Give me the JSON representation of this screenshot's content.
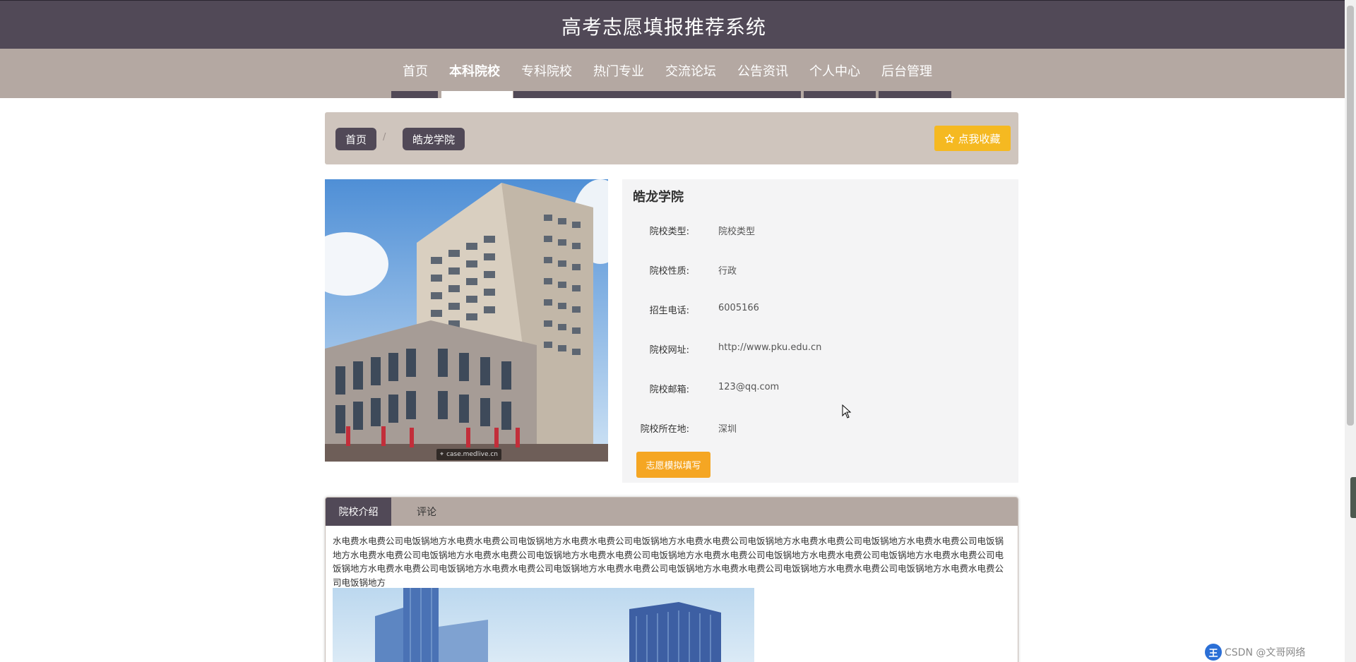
{
  "header": {
    "title": "高考志愿填报推荐系统"
  },
  "nav": {
    "items": [
      {
        "label": "首页"
      },
      {
        "label": "本科院校",
        "active": true
      },
      {
        "label": "专科院校"
      },
      {
        "label": "热门专业"
      },
      {
        "label": "交流论坛"
      },
      {
        "label": "公告资讯"
      },
      {
        "label": "个人中心"
      },
      {
        "label": "后台管理"
      }
    ]
  },
  "breadcrumb": {
    "home": "首页",
    "separator": "/",
    "current": "皓龙学院"
  },
  "favorite_button": {
    "icon": "star-outline-icon",
    "label": "点我收藏"
  },
  "photo": {
    "watermark": "case.medlive.cn"
  },
  "school": {
    "name": "皓龙学院",
    "fields": [
      {
        "label": "院校类型:",
        "value": "院校类型"
      },
      {
        "label": "院校性质:",
        "value": "行政"
      },
      {
        "label": "招生电话:",
        "value": "6005166"
      },
      {
        "label": "院校网址:",
        "value": "http://www.pku.edu.cn"
      },
      {
        "label": "院校邮箱:",
        "value": "123@qq.com"
      },
      {
        "label": "院校所在地:",
        "value": "深圳"
      }
    ],
    "apply_button": "志愿模拟填写"
  },
  "tabs": [
    {
      "label": "院校介绍",
      "active": true
    },
    {
      "label": "评论"
    }
  ],
  "intro": {
    "text": "水电费水电费公司电饭锅地方水电费水电费公司电饭锅地方水电费水电费公司电饭锅地方水电费水电费公司电饭锅地方水电费水电费公司电饭锅地方水电费水电费公司电饭锅地方水电费水电费公司电饭锅地方水电费水电费公司电饭锅地方水电费水电费公司电饭锅地方水电费水电费公司电饭锅地方水电费水电费公司电饭锅地方水电费水电费公司电饭锅地方水电费水电费公司电饭锅地方水电费水电费公司电饭锅地方水电费水电费公司电饭锅地方水电费水电费公司电饭锅地方水电费水电费公司电饭锅地方水电费水电费公司电饭锅地方"
  },
  "tray": {
    "logo": "王",
    "text": "CSDN @文哥网络"
  },
  "colors": {
    "header": "#514957",
    "nav": "#b4a8a2",
    "accent": "#f5b921",
    "apply": "#f5a623"
  }
}
